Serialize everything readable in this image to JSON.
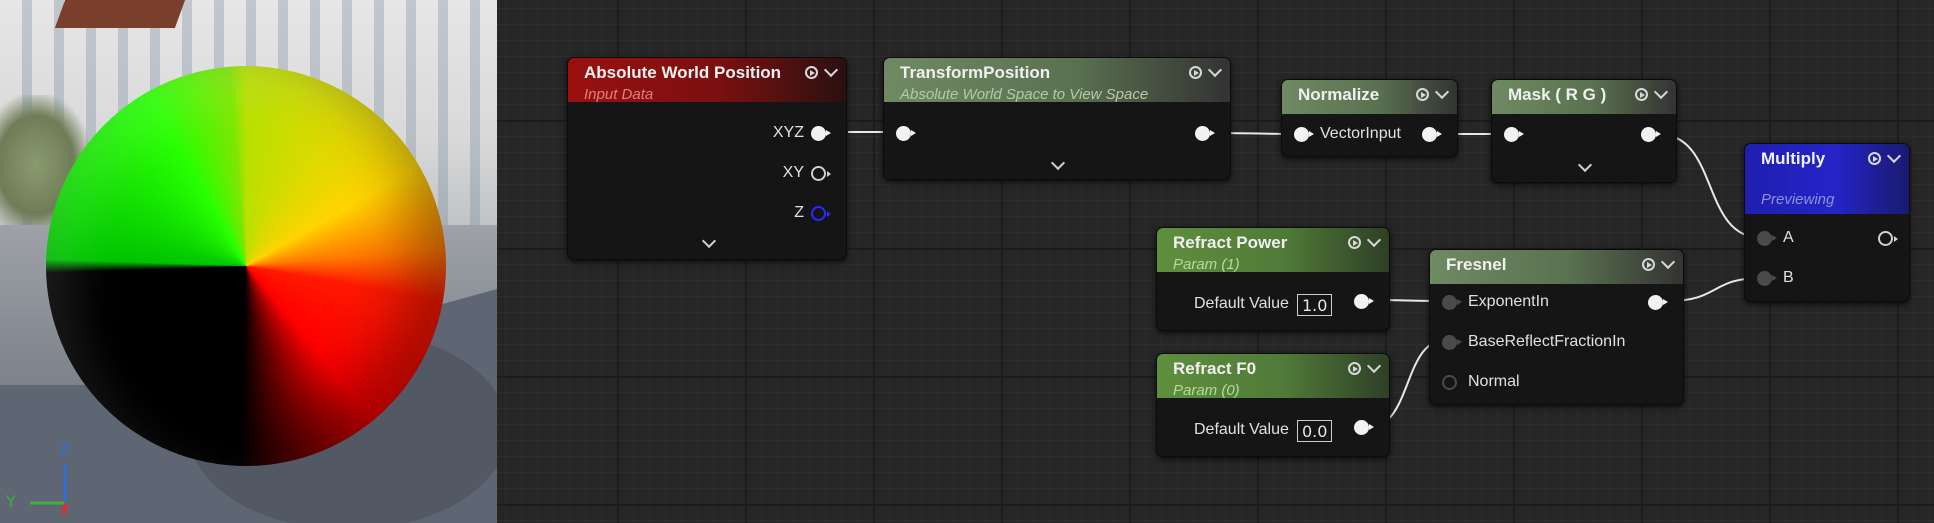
{
  "viewport": {
    "axes": {
      "z": "Z",
      "y": "Y",
      "x": "X"
    },
    "colors": {
      "z_axis": "#2f6fd8",
      "y_axis": "#3fae3f",
      "x_axis": "#d83030"
    }
  },
  "nodes": {
    "absolute_world_position": {
      "title": "Absolute World Position",
      "subtitle": "Input Data",
      "outputs": [
        "XYZ",
        "XY",
        "Z"
      ]
    },
    "transform_position": {
      "title": "TransformPosition",
      "subtitle": "Absolute World Space to View Space"
    },
    "normalize": {
      "title": "Normalize",
      "input": "VectorInput"
    },
    "mask": {
      "title": "Mask ( R G )"
    },
    "multiply": {
      "title": "Multiply",
      "subtitle": "Previewing",
      "inputs": [
        "A",
        "B"
      ]
    },
    "refract_power": {
      "title": "Refract Power",
      "subtitle": "Param (1)",
      "field_label": "Default Value",
      "value": "1.0"
    },
    "refract_f0": {
      "title": "Refract F0",
      "subtitle": "Param (0)",
      "field_label": "Default Value",
      "value": "0.0"
    },
    "fresnel": {
      "title": "Fresnel",
      "inputs": [
        "ExponentIn",
        "BaseReflectFractionIn",
        "Normal"
      ]
    }
  },
  "icons": {
    "preview_toggle": "play-circle-icon",
    "collapse": "chevron-down-icon",
    "expand": "chevron-down-icon"
  }
}
